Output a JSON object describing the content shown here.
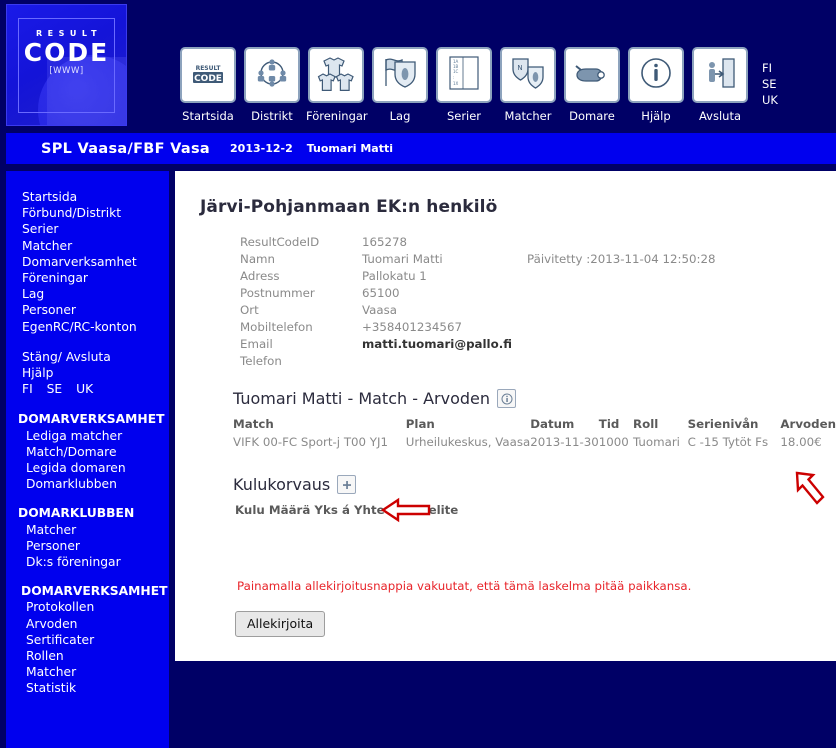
{
  "logo": {
    "result_text": "RESULT",
    "code_text": "CODE",
    "www_text": "[WWW]"
  },
  "nav": {
    "items": [
      {
        "label": "Startsida",
        "icon": "resultcode-logo-icon"
      },
      {
        "label": "Distrikt",
        "icon": "network-people-icon"
      },
      {
        "label": "Föreningar",
        "icon": "jerseys-icon"
      },
      {
        "label": "Lag",
        "icon": "flag-shield-icon"
      },
      {
        "label": "Serier",
        "icon": "standings-list-icon"
      },
      {
        "label": "Matcher",
        "icon": "two-shields-icon"
      },
      {
        "label": "Domare",
        "icon": "whistle-icon"
      },
      {
        "label": "Hjälp",
        "icon": "info-circle-icon"
      },
      {
        "label": "Avsluta",
        "icon": "exit-door-icon"
      }
    ],
    "languages": [
      "FI",
      "SE",
      "UK"
    ]
  },
  "title_bar": {
    "org": "SPL Vaasa/FBF Vasa",
    "date": "2013-12-2",
    "user": "Tuomari Matti"
  },
  "sidebar": {
    "main_links": [
      "Startsida",
      "Förbund/Distrikt",
      "Serier",
      "Matcher",
      "Domarverksamhet",
      "Föreningar",
      "Lag",
      "Personer",
      "EgenRC/RC-konton"
    ],
    "close_links": [
      "Stäng/ Avsluta",
      "Hjälp"
    ],
    "languages": [
      "FI",
      "SE",
      "UK"
    ],
    "group1": {
      "heading": "DOMARVERKSAMHET",
      "links": [
        "Lediga matcher",
        "Match/Domare",
        "Legida domaren",
        "Domarklubben"
      ]
    },
    "group2": {
      "heading": "DOMARKLUBBEN",
      "links": [
        "Matcher",
        "Personer",
        "Dk:s föreningar"
      ]
    },
    "group3": {
      "heading": "DOMARVERKSAMHET",
      "links": [
        "Protokollen",
        "Arvoden",
        "Sertificater",
        "Rollen",
        "Matcher",
        "Statistik"
      ]
    }
  },
  "content": {
    "page_title": "Järvi-Pohjanmaan EK:n henkilö",
    "details": [
      {
        "label": "ResultCodeID",
        "value": "165278",
        "extra": ""
      },
      {
        "label": "Namn",
        "value": "Tuomari Matti",
        "extra": "Päivitetty :2013-11-04 12:50:28"
      },
      {
        "label": "Adress",
        "value": "Pallokatu 1",
        "extra": ""
      },
      {
        "label": "Postnummer",
        "value": "65100",
        "extra": ""
      },
      {
        "label": "Ort",
        "value": "Vaasa",
        "extra": ""
      },
      {
        "label": "Mobiltelefon",
        "value": "+358401234567",
        "extra": ""
      },
      {
        "label": "Email",
        "value": "matti.tuomari@pallo.fi",
        "extra": "",
        "emphasis": true
      },
      {
        "label": "Telefon",
        "value": "",
        "extra": ""
      }
    ],
    "arvoden": {
      "heading": "Tuomari Matti - Match - Arvoden",
      "info_icon": "info-circle-icon",
      "columns": [
        "Match",
        "Plan",
        "Datum",
        "Tid",
        "Roll",
        "Serienivån",
        "Arvoden"
      ],
      "rows": [
        {
          "match": "VIFK 00-FC Sport-j T00 YJ1",
          "plan": "Urheilukeskus, Vaasa",
          "datum": "2013-11-30",
          "tid": "1000",
          "roll": "Tuomari",
          "serieniva": "C -15 Tytöt Fs",
          "arvoden": "18.00€"
        }
      ]
    },
    "kulukorvaus": {
      "heading": "Kulukorvaus",
      "add_icon": "plus-icon",
      "columns_text": "Kulu Määrä Yks á Yhteensä Selite"
    },
    "warning_text": "Painamalla allekirjoitusnappia vakuutat, että tämä laskelma pitää paikkansa.",
    "sign_button": "Allekirjoita"
  },
  "annotations": {
    "kulu_arrow": "left-arrow-annotation",
    "arvoden_arrow": "diagonal-arrow-annotation",
    "color": "#cc0000"
  },
  "colors": {
    "page_bg": "#000066",
    "panel_blue": "#0000ee",
    "content_bg": "#ffffff",
    "warning_red": "#e8252b",
    "annotation_red": "#cc0000"
  }
}
